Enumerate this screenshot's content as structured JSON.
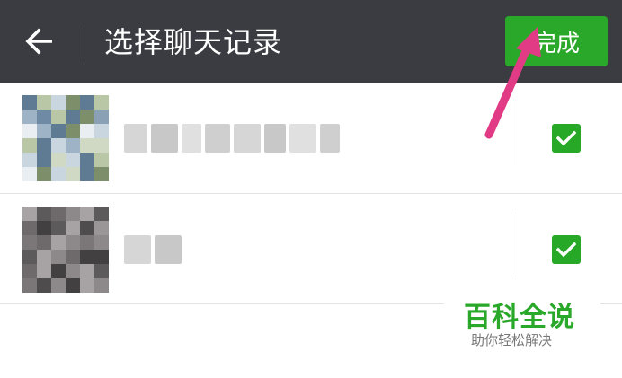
{
  "header": {
    "back_icon": "arrow-left-icon",
    "title": "选择聊天记录",
    "done_label": "完成"
  },
  "chats": [
    {
      "name": "",
      "avatar": "pixelated-photo-collage",
      "selected": true
    },
    {
      "name": "",
      "avatar": "pixelated-grey-photo",
      "selected": true
    }
  ],
  "annotation": {
    "arrow_color": "#e03b84",
    "points_to": "done-button"
  },
  "watermark": {
    "title": "百科全说",
    "subtitle": "助你轻松解决"
  },
  "colors": {
    "header_bg": "#3b3c41",
    "accent_green": "#2aa82a",
    "checkbox_green": "#27a827",
    "arrow_pink": "#e03b84"
  },
  "icons": [
    "arrow-left-icon",
    "checkmark-icon"
  ]
}
